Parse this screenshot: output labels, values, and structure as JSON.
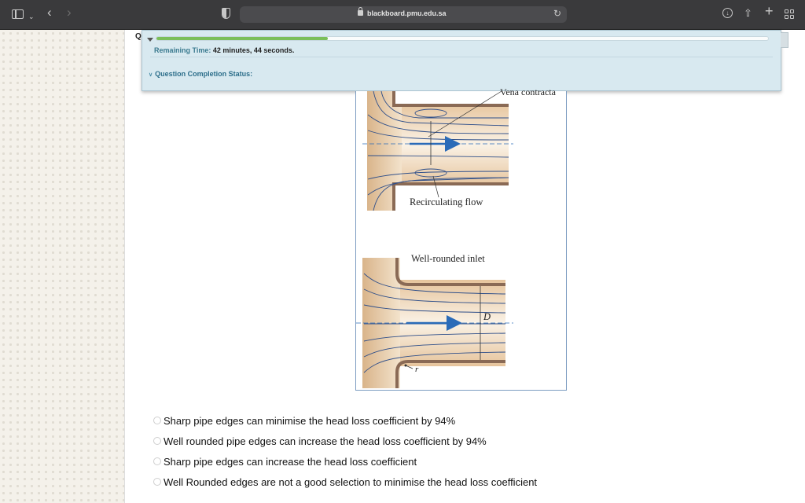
{
  "browser": {
    "url": "blackboard.pmu.edu.sa"
  },
  "question": {
    "label": "Q"
  },
  "timer": {
    "progress": 0.28,
    "remaining_label": "Remaining Time:",
    "remaining_value": "42 minutes, 44 seconds.",
    "completion_label": "Question Completion Status:"
  },
  "figure": {
    "vena_contracta": "Vena contracta",
    "recirculating": "Recirculating flow",
    "well_rounded": "Well-rounded inlet",
    "d_label": "D",
    "r_label": "r"
  },
  "options": [
    {
      "label": "Sharp pipe edges can minimise the head loss coefficient by 94%"
    },
    {
      "label": "Well rounded pipe edges can increase the head loss coefficient by 94%"
    },
    {
      "label": "Sharp pipe edges can increase the head loss coefficient"
    },
    {
      "label": "Well Rounded edges are not a good selection to minimise the head loss coefficient"
    }
  ],
  "colors": {
    "accent": "#2c6e8a",
    "progress": "#7bbf5a",
    "arrow": "#2a6bb8"
  }
}
